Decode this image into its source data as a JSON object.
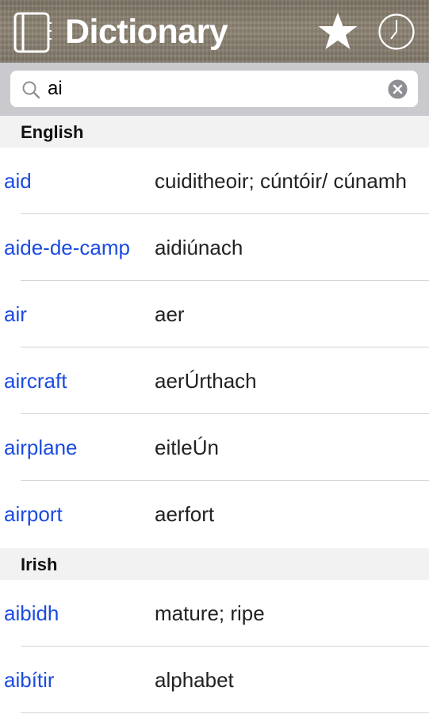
{
  "header": {
    "title": "Dictionary",
    "icons": {
      "book": "book-icon",
      "favorites": "star-icon",
      "history": "clock-icon"
    }
  },
  "search": {
    "value": "ai",
    "placeholder": "",
    "icon": "search-icon",
    "clear_icon": "clear-icon"
  },
  "sections": [
    {
      "title": "English",
      "rows": [
        {
          "term": "aid",
          "definition": "cuiditheoir; cúntóir/ cúnamh"
        },
        {
          "term": "aide-de-camp",
          "definition": "aidiúnach"
        },
        {
          "term": "air",
          "definition": "aer"
        },
        {
          "term": "aircraft",
          "definition": "aerÚrthach"
        },
        {
          "term": "airplane",
          "definition": "eitleÚn"
        },
        {
          "term": "airport",
          "definition": "aerfort"
        }
      ]
    },
    {
      "title": "Irish",
      "rows": [
        {
          "term": "aibidh",
          "definition": "mature; ripe"
        },
        {
          "term": "aibítir",
          "definition": "alphabet"
        }
      ]
    }
  ],
  "colors": {
    "term_link": "#1a4be0",
    "section_bg": "#f2f2f2",
    "search_area_bg": "#c9c9ce"
  }
}
